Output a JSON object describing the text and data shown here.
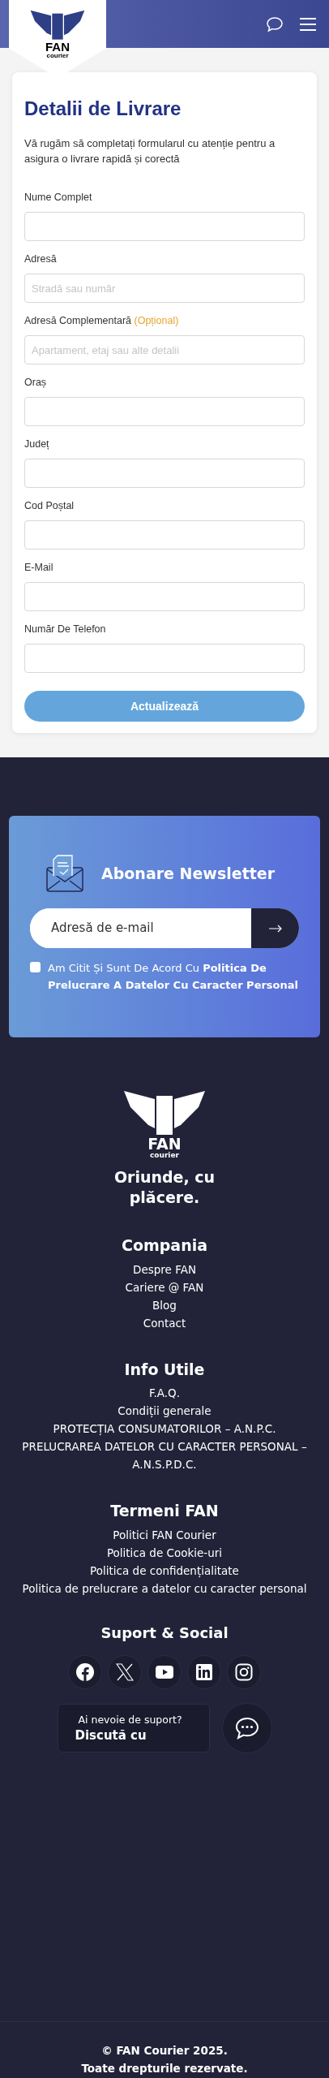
{
  "header": {
    "logo": {
      "name": "FAN",
      "sub": "courier"
    }
  },
  "form": {
    "title": "Detalii de Livrare",
    "intro": "Vă rugăm să completați formularul cu atenție pentru a asigura o livrare rapidă și corectă",
    "fields": [
      {
        "label": "Nume Complet"
      },
      {
        "label": "Adresă",
        "placeholder": "Stradă sau număr"
      },
      {
        "label": "Adresă Complementară",
        "note": "(Opțional)",
        "placeholder": "Apartament, etaj sau alte detalii"
      },
      {
        "label": "Oraș"
      },
      {
        "label": "Județ"
      },
      {
        "label": "Cod Poștal"
      },
      {
        "label": "E-Mail"
      },
      {
        "label": "Număr De Telefon"
      }
    ],
    "button": "Actualizează"
  },
  "newsletter": {
    "title": "Abonare Newsletter",
    "email_placeholder": "Adresă de e-mail",
    "consent": {
      "text": "Am Citit Și Sunt De Acord Cu **Politica De Prelucrare A Datelor Cu Caracter Personal**",
      "checked": false
    }
  },
  "footer": {
    "logo": {
      "name": "FAN",
      "sub": "courier"
    },
    "tagline": "Oriunde, cu plăcere.",
    "sections": [
      {
        "title": "Compania",
        "links": [
          "Despre FAN",
          "Cariere @ FAN",
          "Blog",
          "Contact"
        ]
      },
      {
        "title": "Info Utile",
        "links": [
          "F.A.Q.",
          "Condiții generale",
          "PROTECȚIA CONSUMATORILOR – A.N.P.C.",
          "PRELUCRAREA DATELOR CU CARACTER PERSONAL – A.N.S.P.D.C."
        ]
      },
      {
        "title": "Termeni FAN",
        "links": [
          "Politici FAN Courier",
          "Politica de Cookie-uri",
          "Politica de confidențialitate",
          "Politica de prelucrare a datelor cu caracter personal"
        ]
      }
    ],
    "social_title": "Suport & Social",
    "social": [
      {
        "kind": "facebook"
      },
      {
        "kind": "x"
      },
      {
        "kind": "youtube"
      },
      {
        "kind": "linkedin"
      },
      {
        "kind": "instagram"
      }
    ],
    "support": {
      "question": "Ai nevoie de suport?",
      "action": "Discută cu"
    },
    "copyright": [
      "© FAN Courier 2025.",
      "Toate drepturile rezervate."
    ]
  }
}
